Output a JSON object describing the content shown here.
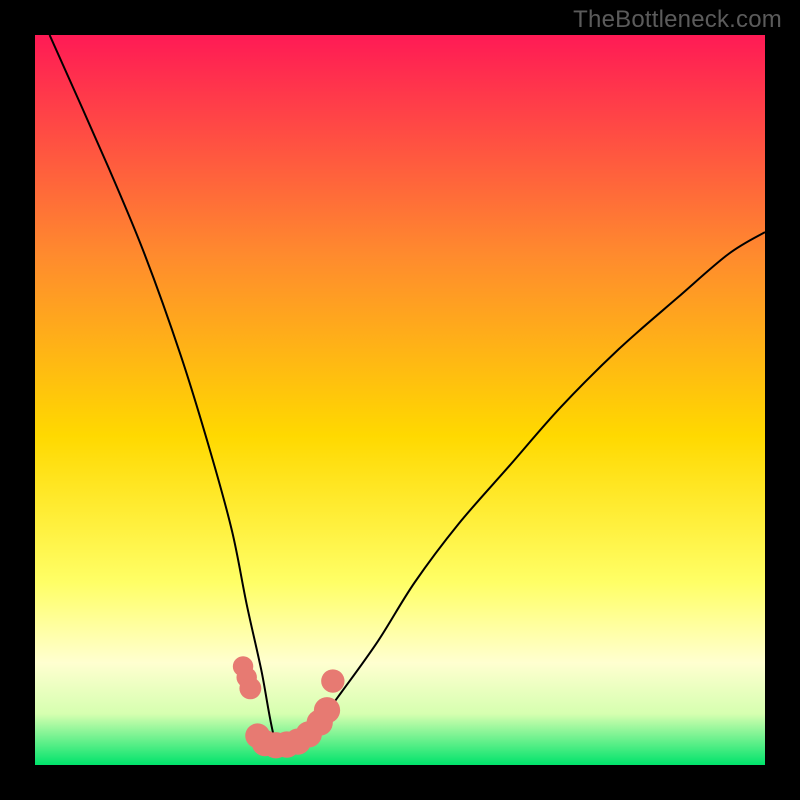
{
  "watermark": "TheBottleneck.com",
  "chart_data": {
    "type": "line",
    "title": "",
    "xlabel": "",
    "ylabel": "",
    "xlim": [
      0,
      100
    ],
    "ylim": [
      0,
      100
    ],
    "background_gradient": {
      "top": "#ff1a55",
      "mid_upper": "#ff8a2e",
      "mid": "#ffd900",
      "mid_lower": "#ffff66",
      "band_light": "#ffffd0",
      "band_pale_green": "#d6ffb0",
      "bottom": "#00e36b"
    },
    "curve": {
      "description": "Asymmetric V / bottleneck curve: left branch descends steeply from top-left toward minimum near x≈33; right branch rises concavely toward upper-right, ending near y≈73 at x=100.",
      "series": [
        {
          "name": "curve",
          "x": [
            2,
            10,
            15,
            20,
            24,
            27,
            29,
            31,
            33,
            35,
            37,
            39,
            42,
            47,
            52,
            58,
            65,
            72,
            80,
            88,
            95,
            100
          ],
          "y": [
            100,
            82,
            70,
            56,
            43,
            32,
            22,
            13,
            3,
            3,
            4,
            6,
            10,
            17,
            25,
            33,
            41,
            49,
            57,
            64,
            70,
            73
          ]
        }
      ]
    },
    "markers": {
      "description": "Salmon-pink beads near curve minimum forming a shallow U, plus two on the left branch slightly above.",
      "color": "#e77a72",
      "points": [
        {
          "x": 28.5,
          "y": 13.5,
          "r": 1.4
        },
        {
          "x": 29.0,
          "y": 12.0,
          "r": 1.4
        },
        {
          "x": 29.5,
          "y": 10.5,
          "r": 1.5
        },
        {
          "x": 30.5,
          "y": 4.0,
          "r": 1.7
        },
        {
          "x": 31.5,
          "y": 3.0,
          "r": 1.8
        },
        {
          "x": 33.0,
          "y": 2.7,
          "r": 1.8
        },
        {
          "x": 34.5,
          "y": 2.8,
          "r": 1.8
        },
        {
          "x": 36.0,
          "y": 3.2,
          "r": 1.8
        },
        {
          "x": 37.5,
          "y": 4.2,
          "r": 1.8
        },
        {
          "x": 39.0,
          "y": 5.8,
          "r": 1.8
        },
        {
          "x": 40.0,
          "y": 7.5,
          "r": 1.8
        },
        {
          "x": 40.8,
          "y": 11.5,
          "r": 1.6
        }
      ]
    }
  }
}
